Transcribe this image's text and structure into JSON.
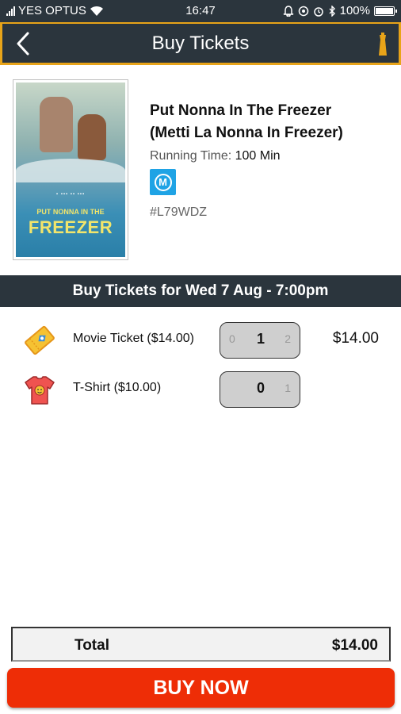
{
  "status_bar": {
    "carrier": "YES OPTUS",
    "time": "16:47",
    "battery": "100%",
    "icons": [
      "signal-icon",
      "wifi-icon",
      "notification-icon",
      "sync-icon",
      "alarm-icon",
      "bluetooth-icon",
      "battery-icon"
    ]
  },
  "header": {
    "title": "Buy Tickets",
    "back_icon": "back-arrow-icon",
    "logo_icon": "tower-icon",
    "border_color": "#e8a419",
    "bg_color": "#2b353d"
  },
  "movie": {
    "poster_text_sub": "PUT NONNA IN THE",
    "poster_text_main": "FREEZER",
    "title_line1": "Put Nonna In The Freezer",
    "title_line2": "(Metti La Nonna In Freezer)",
    "running_label": "Running Time:",
    "running_value": "100 Min",
    "rating": "M",
    "rating_color": "#1fa3e5",
    "code": "#L79WDZ"
  },
  "session": {
    "label": "Buy Tickets for Wed 7 Aug - 7:00pm"
  },
  "items": [
    {
      "label": "Movie Ticket ($14.00)",
      "icon": "ticket-icon",
      "dec": "0",
      "current": "1",
      "inc": "2",
      "price": "$14.00"
    },
    {
      "label": "T-Shirt ($10.00)",
      "icon": "tshirt-icon",
      "dec": "",
      "current": "0",
      "inc": "1",
      "price": ""
    }
  ],
  "total": {
    "label": "Total",
    "amount": "$14.00"
  },
  "buy_button": {
    "label": "BUY NOW",
    "color": "#ee2d06"
  }
}
